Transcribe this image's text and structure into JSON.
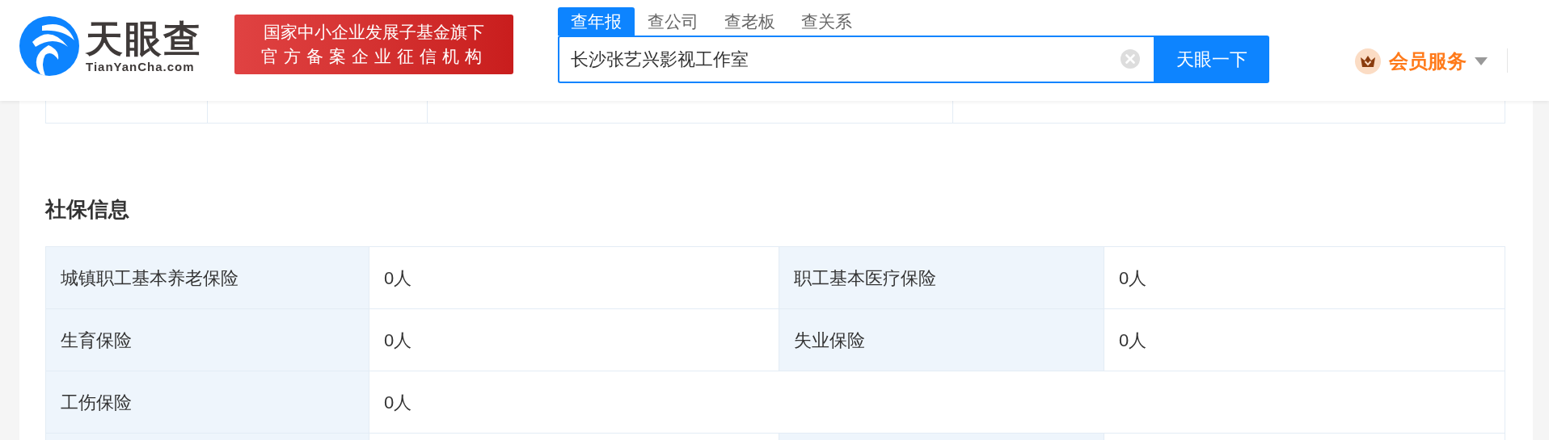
{
  "logo": {
    "name": "天眼查",
    "domain": "TianYanCha.com"
  },
  "badge": {
    "line_1": "国家中小企业发展子基金旗下",
    "line_2": "官方备案企业征信机构"
  },
  "search": {
    "tabs": [
      {
        "label": "查年报",
        "selected": true
      },
      {
        "label": "查公司",
        "selected": false
      },
      {
        "label": "查老板",
        "selected": false
      },
      {
        "label": "查关系",
        "selected": false
      }
    ],
    "value": "长沙张艺兴影视工作室",
    "button": "天眼一下"
  },
  "member_menu": {
    "label": "会员服务"
  },
  "section": {
    "title": "社保信息",
    "rows": [
      {
        "cells": [
          {
            "label": "城镇职工基本养老保险",
            "value": "0人"
          },
          {
            "label": "职工基本医疗保险",
            "value": "0人"
          }
        ]
      },
      {
        "cells": [
          {
            "label": "生育保险",
            "value": "0人"
          },
          {
            "label": "失业保险",
            "value": "0人"
          }
        ]
      },
      {
        "cells": [
          {
            "label": "工伤保险",
            "value": "0人"
          }
        ]
      }
    ]
  }
}
